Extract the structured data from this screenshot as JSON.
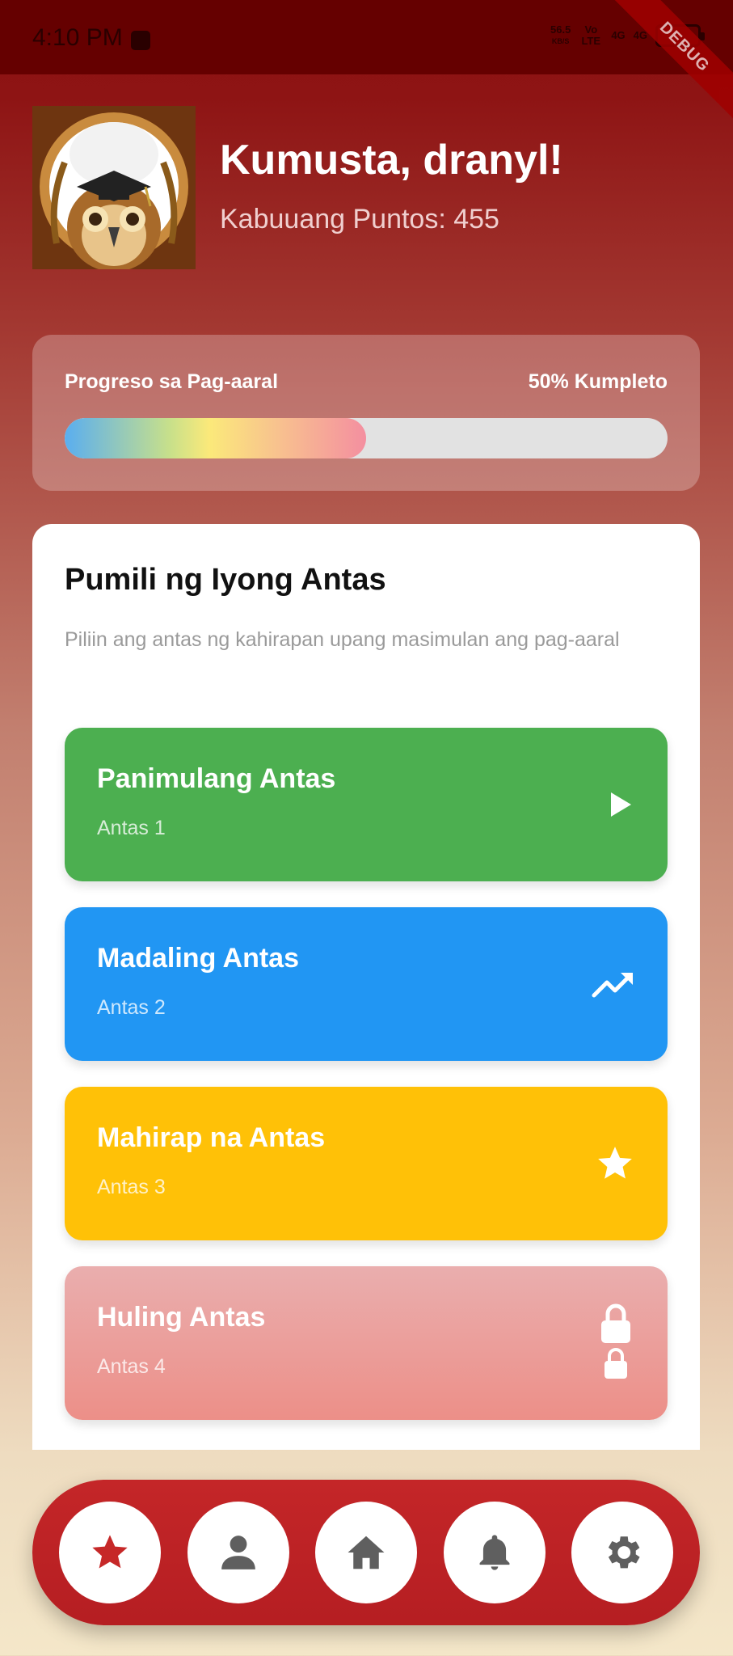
{
  "status_bar": {
    "time": "4:10 PM",
    "speed": "56.5",
    "speed_unit": "KB/S",
    "volte": "Vo LTE",
    "net1": "4G",
    "net2": "4G",
    "debug": "DEBUG"
  },
  "header": {
    "greeting": "Kumusta, dranyl!",
    "points": "Kabuuang Puntos: 455",
    "avatar_icon": "owl-graduate-icon"
  },
  "progress": {
    "label": "Progreso sa Pag-aaral",
    "percent_text": "50% Kumpleto",
    "value": 0.5
  },
  "levels_section": {
    "title": "Pumili ng Iyong Antas",
    "subtitle": "Piliin ang antas ng kahirapan upang masimulan ang pag-aaral",
    "levels": [
      {
        "name": "Panimulang Antas",
        "sub": "Antas 1",
        "icon": "play-icon",
        "color": "#4caf50"
      },
      {
        "name": "Madaling Antas",
        "sub": "Antas 2",
        "icon": "trending-up-icon",
        "color": "#2196f3"
      },
      {
        "name": "Mahirap na Antas",
        "sub": "Antas 3",
        "icon": "star-icon",
        "color": "#ffc107"
      },
      {
        "name": "Huling Antas",
        "sub": "Antas 4",
        "icon": "lock-icon",
        "color": "#ec8f88"
      }
    ]
  },
  "bottom_nav": {
    "items": [
      {
        "icon": "star-icon",
        "color": "#c62828"
      },
      {
        "icon": "person-icon",
        "color": "#5f5f5f"
      },
      {
        "icon": "home-icon",
        "color": "#5f5f5f"
      },
      {
        "icon": "bell-icon",
        "color": "#5f5f5f"
      },
      {
        "icon": "gear-icon",
        "color": "#5f5f5f"
      }
    ]
  }
}
